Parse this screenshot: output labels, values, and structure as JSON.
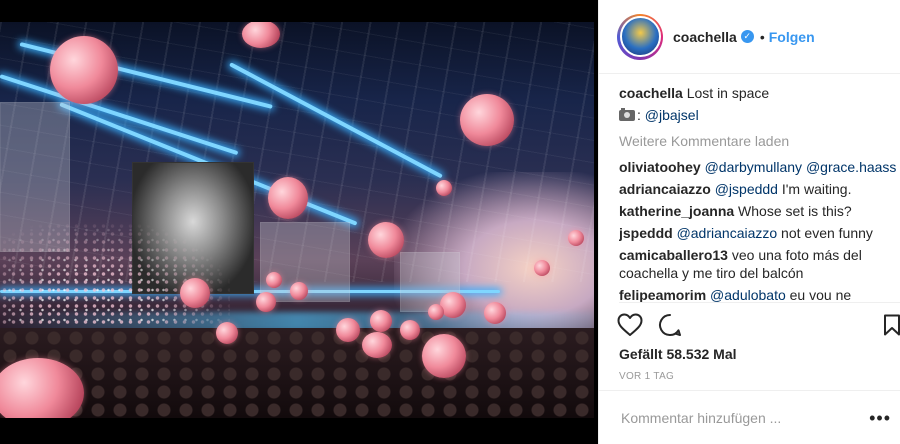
{
  "post": {
    "image_alt": "Concert stage with floating pink balloons"
  },
  "header": {
    "username": "coachella",
    "dot": "•",
    "follow_label": "Folgen"
  },
  "caption": {
    "username": "coachella",
    "text": "Lost in space",
    "credit_prefix": ": ",
    "credit_mention": "@jbajsel"
  },
  "load_more_label": "Weitere Kommentare laden",
  "comments": [
    {
      "user": "oliviatoohey",
      "mentions": [
        "@darbymullany",
        "@grace.haass"
      ],
      "text": ""
    },
    {
      "user": "adriancaiazzo",
      "mentions": [
        "@jspeddd"
      ],
      "text": " I'm waiting."
    },
    {
      "user": "katherine_joanna",
      "mentions": [],
      "text": "Whose set is this?"
    },
    {
      "user": "jspeddd",
      "mentions": [
        "@adriancaiazzo"
      ],
      "text": " not even funny"
    },
    {
      "user": "camicaballero13",
      "mentions": [],
      "text": "veo una foto más del coachella y me tiro del balcón"
    },
    {
      "user": "felipeamorim",
      "mentions": [
        "@adulobato"
      ],
      "text": " eu vou ne"
    }
  ],
  "likes": "Gefällt 58.532 Mal",
  "age": "VOR 1 TAG",
  "comment_input": {
    "placeholder": "Kommentar hinzufügen ..."
  },
  "more_label": "•••",
  "icons": {
    "like": "heart-outline-icon",
    "comment": "speech-bubble-icon",
    "save": "bookmark-icon",
    "verified": "verified-badge-icon",
    "camera": "camera-icon"
  },
  "colors": {
    "link_blue": "#3897f0",
    "mention": "#003569",
    "text": "#262626",
    "muted": "#999999"
  }
}
